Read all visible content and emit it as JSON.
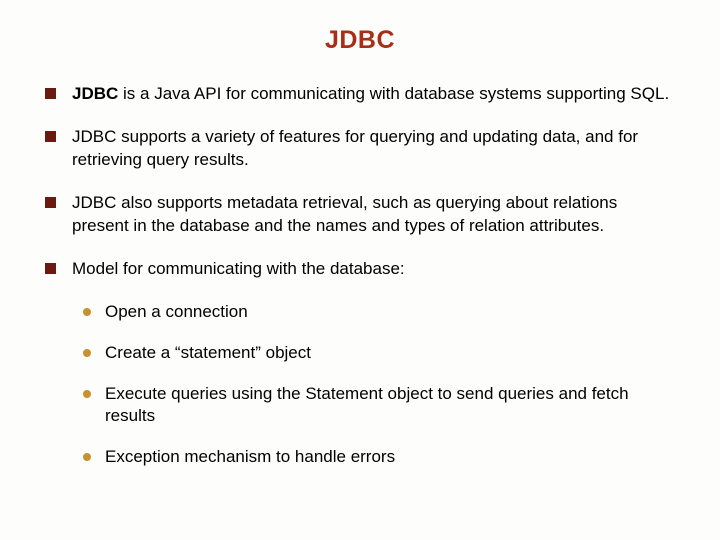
{
  "title": "JDBC",
  "b1_bold": "JDBC",
  "b1_rest": " is a Java API for communicating with database systems supporting SQL.",
  "b2": "JDBC supports a variety of features for querying and updating data, and for retrieving query results.",
  "b3": "JDBC also supports metadata retrieval, such as querying about relations present in the database and the names and types of relation attributes.",
  "b4": "Model for communicating with the database:",
  "s1": "Open a connection",
  "s2": "Create a “statement” object",
  "s3": "Execute queries using the Statement object to send queries and fetch results",
  "s4": "Exception mechanism to handle errors"
}
